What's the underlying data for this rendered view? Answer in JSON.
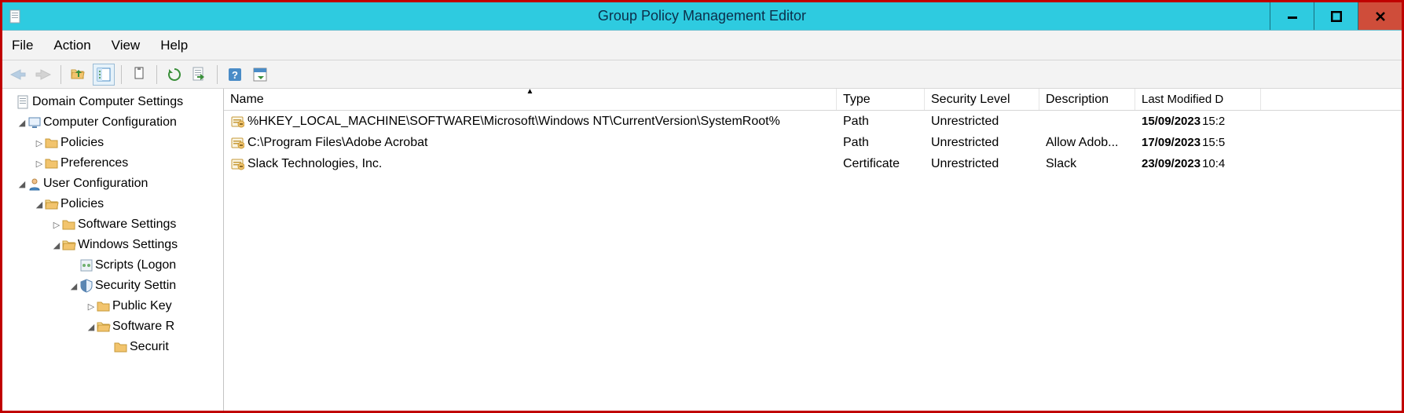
{
  "window": {
    "title": "Group Policy Management Editor"
  },
  "menu": {
    "file": "File",
    "action": "Action",
    "view": "View",
    "help": "Help"
  },
  "columns": {
    "name": "Name",
    "type": "Type",
    "security": "Security Level",
    "description": "Description",
    "modified": "Last Modified D"
  },
  "tree": {
    "root": "Domain Computer Settings",
    "comp": "Computer Configuration",
    "comp_policies": "Policies",
    "comp_prefs": "Preferences",
    "user": "User Configuration",
    "user_policies": "Policies",
    "sw_settings": "Software Settings",
    "win_settings": "Windows Settings",
    "scripts": "Scripts (Logon",
    "sec_settings": "Security Settin",
    "public_key": "Public Key",
    "software_r": "Software R",
    "security_l": "Securit"
  },
  "rules": [
    {
      "name": "%HKEY_LOCAL_MACHINE\\SOFTWARE\\Microsoft\\Windows NT\\CurrentVersion\\SystemRoot%",
      "type": "Path",
      "security": "Unrestricted",
      "description": "",
      "date": "15/09/2023",
      "time": "15:2"
    },
    {
      "name": "C:\\Program Files\\Adobe Acrobat",
      "type": "Path",
      "security": "Unrestricted",
      "description": "Allow Adob...",
      "date": "17/09/2023",
      "time": "15:5"
    },
    {
      "name": "Slack Technologies, Inc.",
      "type": "Certificate",
      "security": "Unrestricted",
      "description": "Slack",
      "date": "23/09/2023",
      "time": "10:4"
    }
  ]
}
